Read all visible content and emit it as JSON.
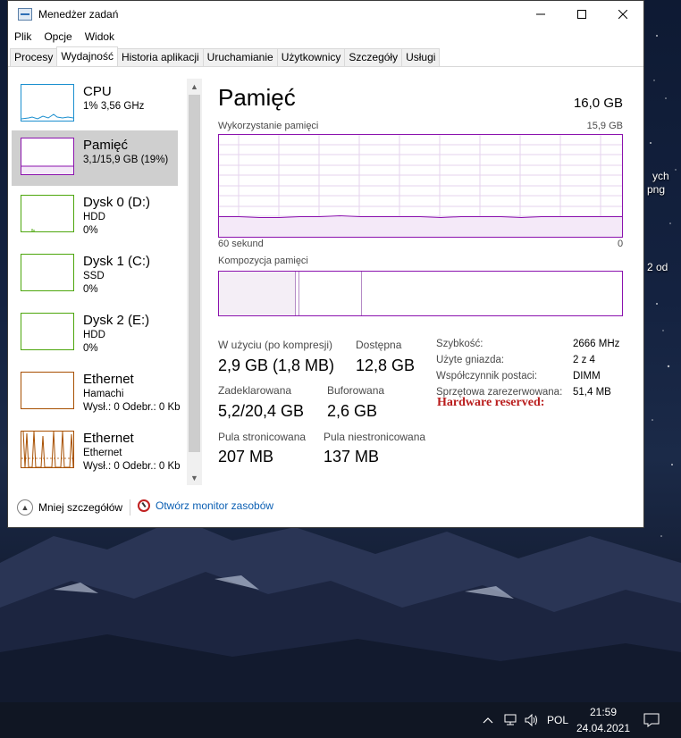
{
  "window": {
    "title": "Menedżer zadań"
  },
  "menu": [
    "Plik",
    "Opcje",
    "Widok"
  ],
  "tabs": [
    "Procesy",
    "Wydajność",
    "Historia aplikacji",
    "Uruchamianie",
    "Użytkownicy",
    "Szczegóły",
    "Usługi"
  ],
  "active_tab": "Wydajność",
  "resources": [
    {
      "name": "CPU",
      "line1": "1% 3,56 GHz",
      "line2": "",
      "color": "#1b8fcf"
    },
    {
      "name": "Pamięć",
      "line1": "3,1/15,9 GB (19%)",
      "line2": "",
      "color": "#8b12ae"
    },
    {
      "name": "Dysk 0 (D:)",
      "line1": "HDD",
      "line2": "0%",
      "color": "#4da60c"
    },
    {
      "name": "Dysk 1 (C:)",
      "line1": "SSD",
      "line2": "0%",
      "color": "#4da60c"
    },
    {
      "name": "Dysk 2 (E:)",
      "line1": "HDD",
      "line2": "0%",
      "color": "#4da60c"
    },
    {
      "name": "Ethernet",
      "line1": "Hamachi",
      "line2": "Wysł.: 0 Odebr.: 0 Kb",
      "color": "#a74f01"
    },
    {
      "name": "Ethernet",
      "line1": "Ethernet",
      "line2": "Wysł.: 0 Odebr.: 0 Kb",
      "color": "#a74f01"
    }
  ],
  "selected_resource": "Pamięć",
  "memory": {
    "title": "Pamięć",
    "total": "16,0 GB",
    "usage_label": "Wykorzystanie pamięci",
    "usage_max": "15,9 GB",
    "time_left": "60 sekund",
    "time_right": "0",
    "composition_label": "Kompozycja pamięci",
    "usage_fraction": 0.19
  },
  "stats": {
    "in_use_label": "W użyciu (po kompresji)",
    "in_use_value": "2,9 GB (1,8 MB)",
    "available_label": "Dostępna",
    "available_value": "12,8 GB",
    "committed_label": "Zadeklarowana",
    "committed_value": "5,2/20,4 GB",
    "cached_label": "Buforowana",
    "cached_value": "2,6 GB",
    "paged_label": "Pula stronicowana",
    "paged_value": "207 MB",
    "nonpaged_label": "Pula niestronicowana",
    "nonpaged_value": "137 MB"
  },
  "properties": [
    {
      "label": "Szybkość:",
      "value": "2666 MHz"
    },
    {
      "label": "Użyte gniazda:",
      "value": "2 z 4"
    },
    {
      "label": "Współczynnik postaci:",
      "value": "DIMM"
    },
    {
      "label": "Sprzętowa zarezerwowana:",
      "value": "51,4 MB"
    }
  ],
  "overlay_text": "Hardware reserved:",
  "footer": {
    "fewer_details": "Mniej szczegółów",
    "open_monitor": "Otwórz monitor zasobów"
  },
  "desktop_labels": [
    "ych",
    "png",
    "2 od"
  ],
  "taskbar": {
    "language": "POL",
    "time": "21:59",
    "date": "24.04.2021"
  }
}
